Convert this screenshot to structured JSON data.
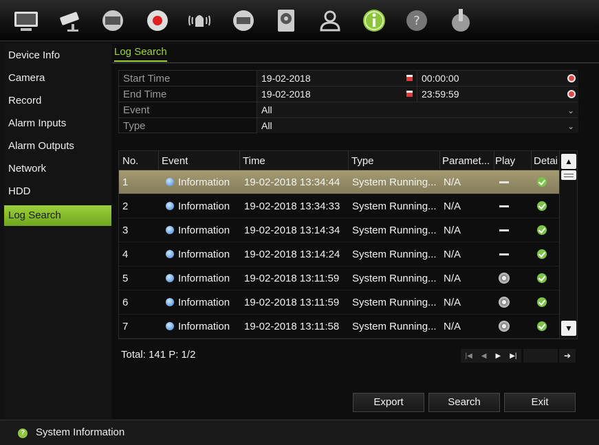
{
  "toolbar": {
    "icons": [
      "monitor-icon",
      "camera-icon",
      "playback-icon",
      "record-icon",
      "alarm-icon",
      "network-icon",
      "hdd-icon",
      "user-icon",
      "info-icon",
      "help-icon",
      "power-icon"
    ],
    "active": "info-icon"
  },
  "sidebar": {
    "items": [
      {
        "label": "Device Info"
      },
      {
        "label": "Camera"
      },
      {
        "label": "Record"
      },
      {
        "label": "Alarm Inputs"
      },
      {
        "label": "Alarm Outputs"
      },
      {
        "label": "Network"
      },
      {
        "label": "HDD"
      },
      {
        "label": "Log Search"
      }
    ],
    "active": "Log Search"
  },
  "tab": {
    "label": "Log Search"
  },
  "filter": {
    "start_label": "Start Time",
    "start_date": "19-02-2018",
    "start_time": "00:00:00",
    "end_label": "End Time",
    "end_date": "19-02-2018",
    "end_time": "23:59:59",
    "event_label": "Event",
    "event_value": "All",
    "type_label": "Type",
    "type_value": "All"
  },
  "table": {
    "headers": [
      "No.",
      "Event",
      "Time",
      "Type",
      "Paramet...",
      "Play",
      "Detai"
    ],
    "rows": [
      {
        "no": "1",
        "event": "Information",
        "time": "19-02-2018 13:34:44",
        "type": "System Running...",
        "param": "N/A",
        "play": "dash",
        "detail": "ok"
      },
      {
        "no": "2",
        "event": "Information",
        "time": "19-02-2018 13:34:33",
        "type": "System Running...",
        "param": "N/A",
        "play": "dash",
        "detail": "ok"
      },
      {
        "no": "3",
        "event": "Information",
        "time": "19-02-2018 13:14:34",
        "type": "System Running...",
        "param": "N/A",
        "play": "dash",
        "detail": "ok"
      },
      {
        "no": "4",
        "event": "Information",
        "time": "19-02-2018 13:14:24",
        "type": "System Running...",
        "param": "N/A",
        "play": "dash",
        "detail": "ok"
      },
      {
        "no": "5",
        "event": "Information",
        "time": "19-02-2018 13:11:59",
        "type": "System Running...",
        "param": "N/A",
        "play": "button",
        "detail": "ok"
      },
      {
        "no": "6",
        "event": "Information",
        "time": "19-02-2018 13:11:59",
        "type": "System Running...",
        "param": "N/A",
        "play": "button",
        "detail": "ok"
      },
      {
        "no": "7",
        "event": "Information",
        "time": "19-02-2018 13:11:58",
        "type": "System Running...",
        "param": "N/A",
        "play": "button",
        "detail": "ok"
      }
    ],
    "selected_row": "1"
  },
  "footer": {
    "total": "Total: 141  P: 1/2"
  },
  "buttons": {
    "export": "Export",
    "search": "Search",
    "exit": "Exit"
  },
  "status": {
    "text": "System Information"
  },
  "colors": {
    "accent": "#9fd43a",
    "selected_row": "#958d67"
  }
}
